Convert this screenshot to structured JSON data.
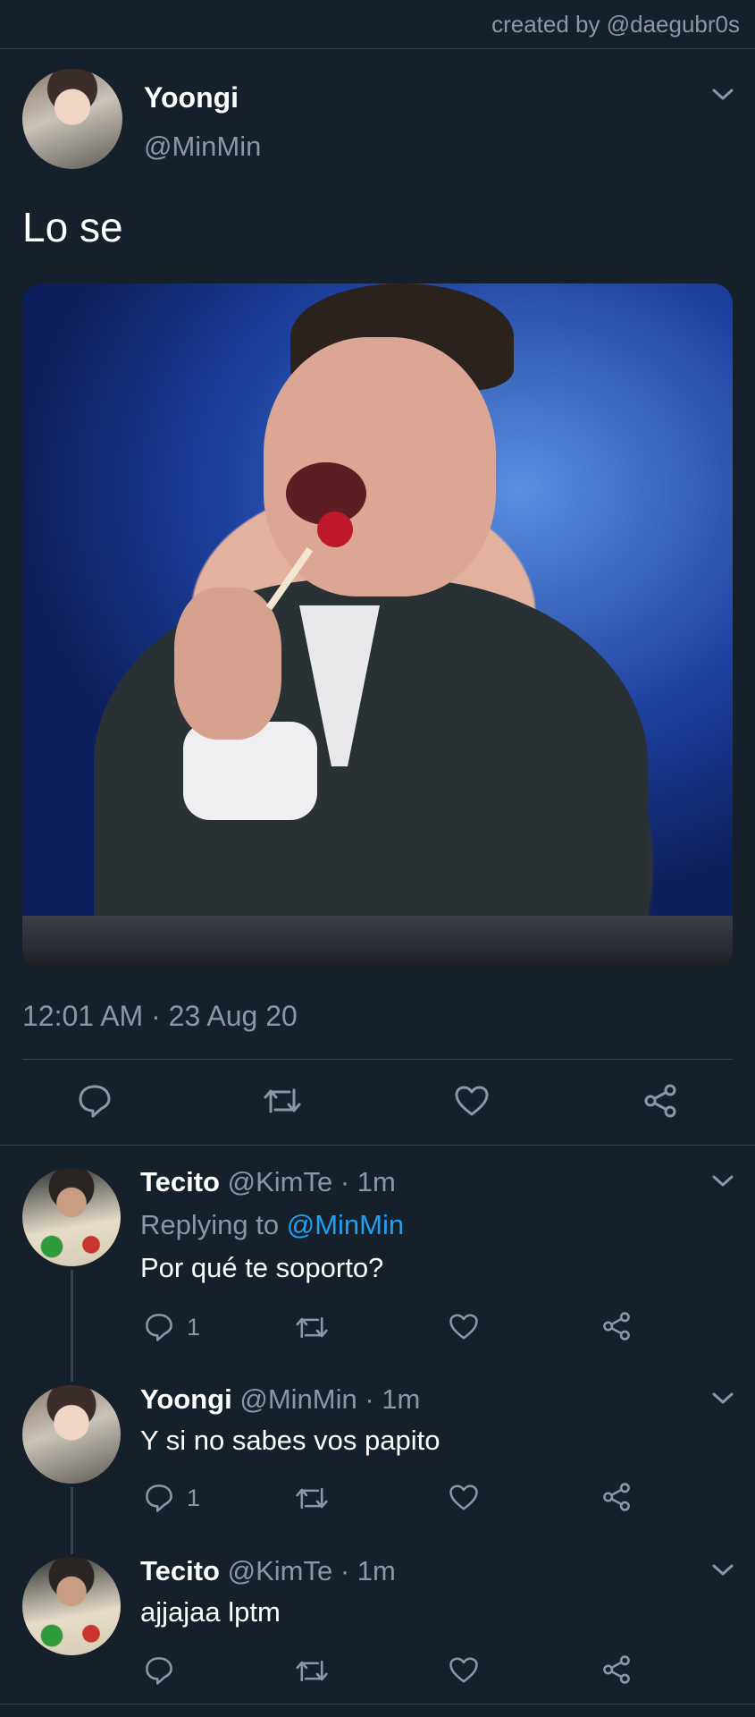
{
  "watermark": "created by @daegubr0s",
  "main_tweet": {
    "display_name": "Yoongi",
    "handle": "@MinMin",
    "text": "Lo se",
    "timestamp": "12:01 AM · 23 Aug 20"
  },
  "replies": [
    {
      "display_name": "Tecito",
      "handle": "@KimTe",
      "time": "· 1m",
      "replying_prefix": "Replying to",
      "replying_to": "@MinMin",
      "text": "Por qué te soporto?",
      "reply_count": "1"
    },
    {
      "display_name": "Yoongi",
      "handle": "@MinMin",
      "time": "· 1m",
      "text": "Y si no sabes vos papito",
      "reply_count": "1"
    },
    {
      "display_name": "Tecito",
      "handle": "@KimTe",
      "time": "· 1m",
      "text": "ajjajaa lptm",
      "reply_count": ""
    }
  ],
  "colors": {
    "background": "#15202b",
    "divider": "#38444d",
    "muted": "#8899a6",
    "link": "#1da1f2",
    "text": "#ffffff"
  },
  "icons": [
    "chevron-down-icon",
    "reply-icon",
    "retweet-icon",
    "like-icon",
    "share-icon"
  ]
}
